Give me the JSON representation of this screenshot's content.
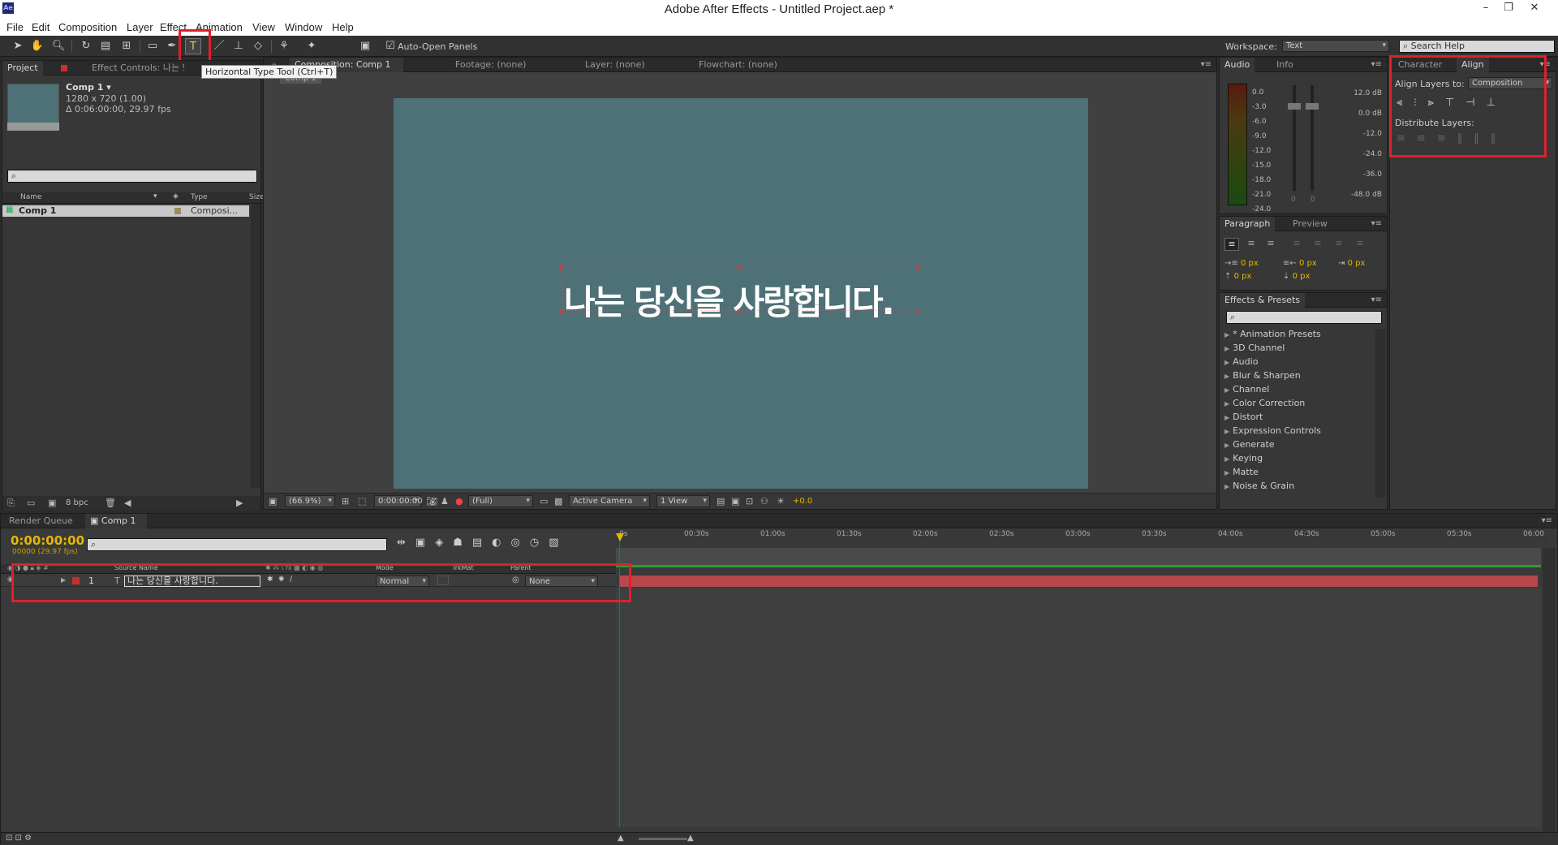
{
  "app": {
    "title": "Adobe After Effects - Untitled Project.aep *",
    "logo": "Ae"
  },
  "window_controls": [
    "–",
    "❐",
    "✕"
  ],
  "menu": [
    "File",
    "Edit",
    "Composition",
    "Layer",
    "Effect",
    "Animation",
    "View",
    "Window",
    "Help"
  ],
  "toolbar": {
    "auto_open_panels": "Auto-Open Panels",
    "tooltip": "Horizontal Type Tool (Ctrl+T)",
    "workspace_label": "Workspace:",
    "workspace_value": "Text",
    "search_help": "Search Help"
  },
  "project": {
    "tab_project": "Project",
    "tab_effect_controls": "Effect Controls: 나는 당신",
    "comp_name": "Comp 1 ▾",
    "comp_size": "1280 x 720 (1.00)",
    "comp_duration": "Δ 0:06:00:00, 29.97 fps",
    "col_name": "Name",
    "col_type": "Type",
    "col_size": "Size",
    "item_name": "Comp 1",
    "item_type": "Composi...",
    "bpc": "8 bpc"
  },
  "viewer": {
    "tab_comp": "Composition: Comp 1",
    "tab_footage": "Footage: (none)",
    "tab_layer": "Layer: (none)",
    "tab_flowchart": "Flowchart: (none)",
    "sub_tab": "Comp 1",
    "text": "나는 당신을 사랑합니다.",
    "bg_color": "#4d7177",
    "zoom": "(66.9%)",
    "timecode": "0:00:00:00",
    "resolution": "(Full)",
    "camera": "Active Camera",
    "views": "1 View",
    "exposure": "+0.0"
  },
  "audio": {
    "tab_audio": "Audio",
    "tab_info": "Info",
    "left_scale": [
      "0.0",
      "-3.0",
      "-6.0",
      "-9.0",
      "-12.0",
      "-15.0",
      "-18.0",
      "-21.0",
      "-24.0"
    ],
    "right_scale": [
      "12.0 dB",
      "0.0 dB",
      "-12.0",
      "-24.0",
      "-36.0",
      "-48.0 dB"
    ],
    "zero": "0"
  },
  "paragraph": {
    "tab_paragraph": "Paragraph",
    "tab_preview": "Preview",
    "indent_values": [
      "0 px",
      "0 px",
      "0 px",
      "0 px",
      "0 px"
    ]
  },
  "effects": {
    "tab": "Effects & Presets",
    "items": [
      "* Animation Presets",
      "3D Channel",
      "Audio",
      "Blur & Sharpen",
      "Channel",
      "Color Correction",
      "Distort",
      "Expression Controls",
      "Generate",
      "Keying",
      "Matte",
      "Noise & Grain"
    ]
  },
  "align": {
    "tab_character": "Character",
    "tab_align": "Align",
    "align_to_label": "Align Layers to:",
    "align_to_value": "Composition",
    "distribute_label": "Distribute Layers:"
  },
  "timeline": {
    "tab_render": "Render Queue",
    "tab_comp": "Comp 1",
    "timecode": "0:00:00:00",
    "frames": "00000 (29.97 fps)",
    "ruler": [
      "0s",
      "00:30s",
      "01:00s",
      "01:30s",
      "02:00s",
      "02:30s",
      "03:00s",
      "03:30s",
      "04:00s",
      "04:30s",
      "05:00s",
      "05:30s",
      "06:00"
    ],
    "col_source": "Source Name",
    "col_mode": "Mode",
    "col_trkmat": "TrkMat",
    "col_parent": "Parent",
    "layer_num": "1",
    "layer_name": "나는 당신을 사랑합니다.",
    "layer_mode": "Normal",
    "layer_parent": "None",
    "label_color": "#c83030",
    "bar_color": "#b8484c"
  }
}
